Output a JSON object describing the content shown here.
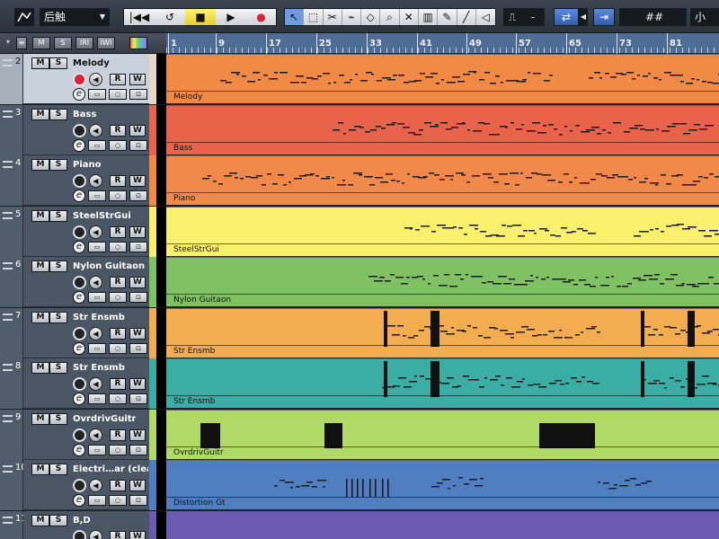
{
  "toolbar": {
    "automation_icon": "automation-curve-icon",
    "mode_value": "后触",
    "transport": {
      "goto_start": "|◀◀",
      "cycle": "↺",
      "stop": "■",
      "play": "▶",
      "record": "●"
    },
    "quantize_value": "-",
    "grid_symbol": "##",
    "grid_extra": "小"
  },
  "header_buttons": [
    "M",
    "S",
    "IRI",
    "IWI"
  ],
  "ruler": {
    "labels": [
      "1",
      "9",
      "17",
      "25",
      "33",
      "41",
      "49",
      "57",
      "65",
      "73",
      "81"
    ]
  },
  "tracks": [
    {
      "number": "2",
      "name": "Melody",
      "part_name": "Melody",
      "color": "#f08a45",
      "strip": "#e8d7c7",
      "selected": true,
      "record_on": true
    },
    {
      "number": "3",
      "name": "Bass",
      "part_name": "Bass",
      "color": "#e9634a",
      "strip": "#e9634a",
      "selected": false,
      "record_on": false
    },
    {
      "number": "4",
      "name": "Piano",
      "part_name": "Piano",
      "color": "#f0894a",
      "strip": "#f08a45",
      "selected": false,
      "record_on": false
    },
    {
      "number": "5",
      "name": "SteelStrGui",
      "part_name": "SteelStrGui",
      "color": "#fbf06e",
      "strip": "#fbf06e",
      "selected": false,
      "record_on": false
    },
    {
      "number": "6",
      "name": "Nylon Guitaon",
      "part_name": "Nylon Guitaon",
      "color": "#80c163",
      "strip": "#80c163",
      "selected": false,
      "record_on": false
    },
    {
      "number": "7",
      "name": "Str Ensmb",
      "part_name": "Str Ensmb",
      "color": "#f3ac50",
      "strip": "#f3ac50",
      "selected": false,
      "record_on": false
    },
    {
      "number": "8",
      "name": "Str Ensmb",
      "part_name": "Str Ensmb",
      "color": "#3aada4",
      "strip": "#3aada4",
      "selected": false,
      "record_on": false
    },
    {
      "number": "9",
      "name": "OvrdrivGuitr",
      "part_name": "OvrdrivGuitr",
      "color": "#b0d965",
      "strip": "#b0d965",
      "selected": false,
      "record_on": false
    },
    {
      "number": "10",
      "name": "Electri…ar (clear",
      "part_name": "Distortion Gt",
      "color": "#4f7fc0",
      "strip": "#4f7fc0",
      "selected": false,
      "record_on": false
    },
    {
      "number": "11",
      "name": "B,D",
      "part_name": "",
      "color": "#6a5bb0",
      "strip": "#6a5bb0",
      "selected": false,
      "record_on": false
    }
  ],
  "track_buttons": {
    "mute": "M",
    "solo": "S",
    "read": "R",
    "write": "W",
    "edit": "e",
    "monitor": "◀"
  }
}
